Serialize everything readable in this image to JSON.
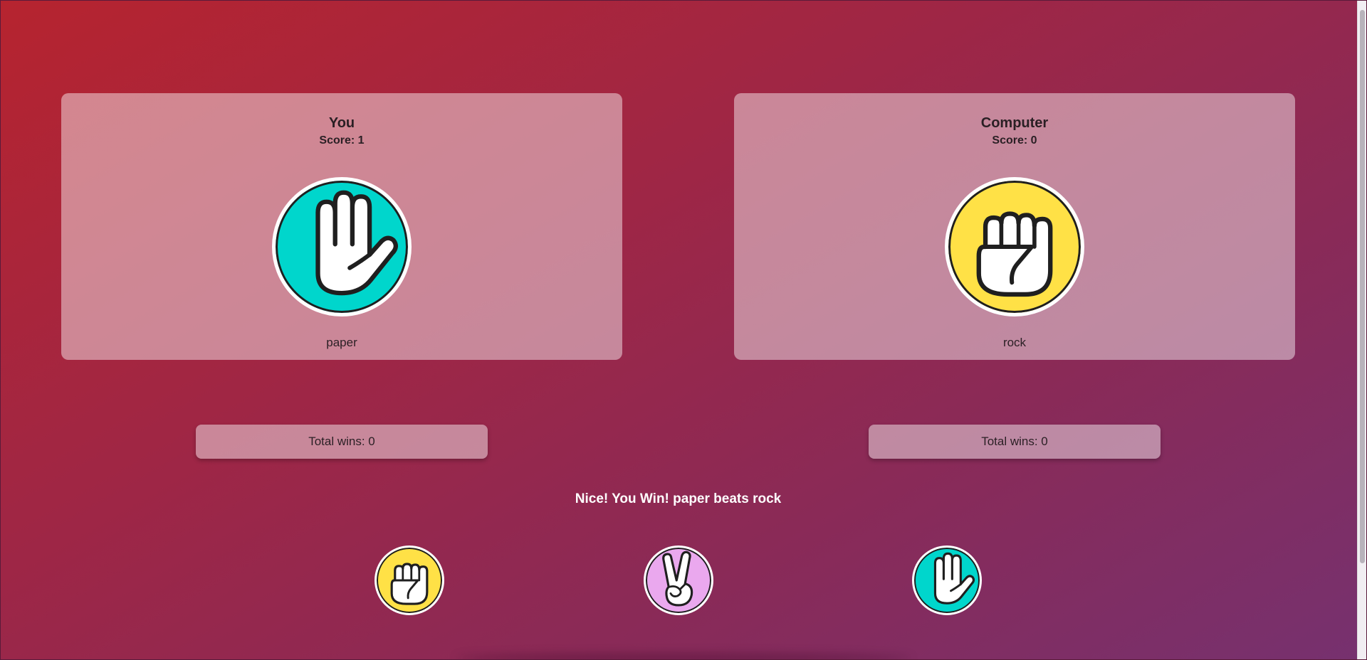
{
  "player": {
    "name": "You",
    "score_label": "Score: 1",
    "choice": "paper",
    "choice_icon": "paper-hand-icon",
    "total_wins_label": "Total wins: 0"
  },
  "computer": {
    "name": "Computer",
    "score_label": "Score: 0",
    "choice": "rock",
    "choice_icon": "rock-fist-icon",
    "total_wins_label": "Total wins: 0"
  },
  "result_message": "Nice! You Win! paper beats rock",
  "options": [
    {
      "id": "rock",
      "icon": "rock-fist-icon",
      "color": "#ffe146"
    },
    {
      "id": "scissors",
      "icon": "scissors-hand-icon",
      "color": "#eaa8ee"
    },
    {
      "id": "paper",
      "icon": "paper-hand-icon",
      "color": "#00d6cc"
    }
  ],
  "colors": {
    "rock": "#ffe146",
    "scissors": "#eaa8ee",
    "paper": "#00d6cc",
    "outline": "#1f1f1f",
    "result_text": "#ffffff"
  }
}
